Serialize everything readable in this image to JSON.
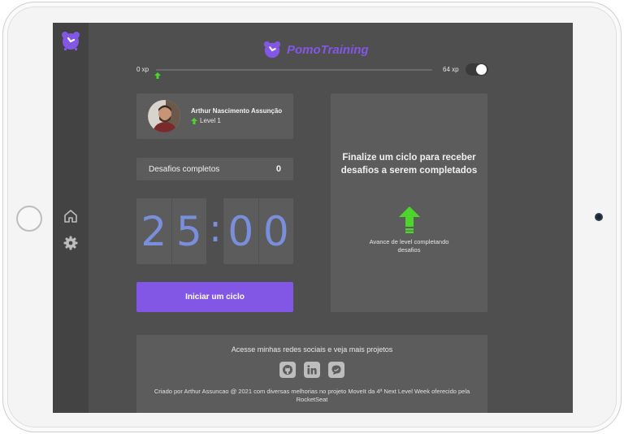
{
  "brand": {
    "name": "PomoTraining",
    "accent_color": "#8257e5"
  },
  "sidebar": {
    "items": [
      {
        "icon": "home-icon"
      },
      {
        "icon": "gear-icon"
      }
    ]
  },
  "xp": {
    "start_label": "0 xp",
    "end_label": "64 xp",
    "progress": 0
  },
  "profile": {
    "name": "Arthur Nascimento Assunção",
    "level_label": "Level 1"
  },
  "challenges": {
    "label": "Desafios completos",
    "count": "0"
  },
  "timer": {
    "minutes": [
      "2",
      "5"
    ],
    "separator": ":",
    "seconds": [
      "0",
      "0"
    ]
  },
  "start_button": {
    "label": "Iniciar um ciclo"
  },
  "challenge_panel": {
    "title": "Finalize um ciclo para receber desafios a serem completados",
    "subtitle": "Avance de level completando desafios"
  },
  "footer": {
    "title": "Acesse minhas redes sociais e veja mais projetos",
    "social": [
      "github-icon",
      "linkedin-icon",
      "chat-icon"
    ],
    "credits": "Criado por Arthur Assuncao @ 2021 com diversas melhorias no projeto MoveIt da 4ª Next Level Week oferecido pela RocketSeat"
  },
  "colors": {
    "background": "#4f4f4f",
    "card": "#5c5c5c",
    "timer_digits": "#7a8fdc",
    "level_up": "#4cd62b"
  }
}
